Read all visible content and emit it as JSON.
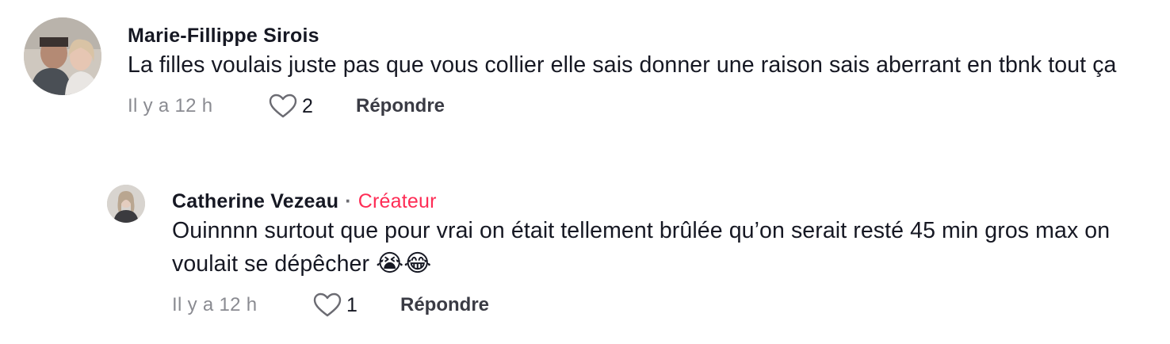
{
  "comments": [
    {
      "username": "Marie-Fillippe Sirois",
      "text": "La filles voulais juste pas que vous collier elle sais donner une raison sais aberrant en tbnk tout ça",
      "time": "Il y a 12 h",
      "likes": "2",
      "reply_label": "Répondre"
    },
    {
      "username": "Catherine Vezeau",
      "separator": "·",
      "badge": "Créateur",
      "text": "Ouinnnn surtout que pour vrai on était tellement brûlée qu’on serait resté 45 min gros max on voulait se dépêcher",
      "emojis": "😭😂",
      "time": "Il y a 12 h",
      "likes": "1",
      "reply_label": "Répondre"
    }
  ],
  "colors": {
    "creator_badge": "#fe2c55",
    "text": "#161823",
    "muted": "#8a8b91"
  },
  "icons": {
    "like": "heart-outline-icon"
  }
}
